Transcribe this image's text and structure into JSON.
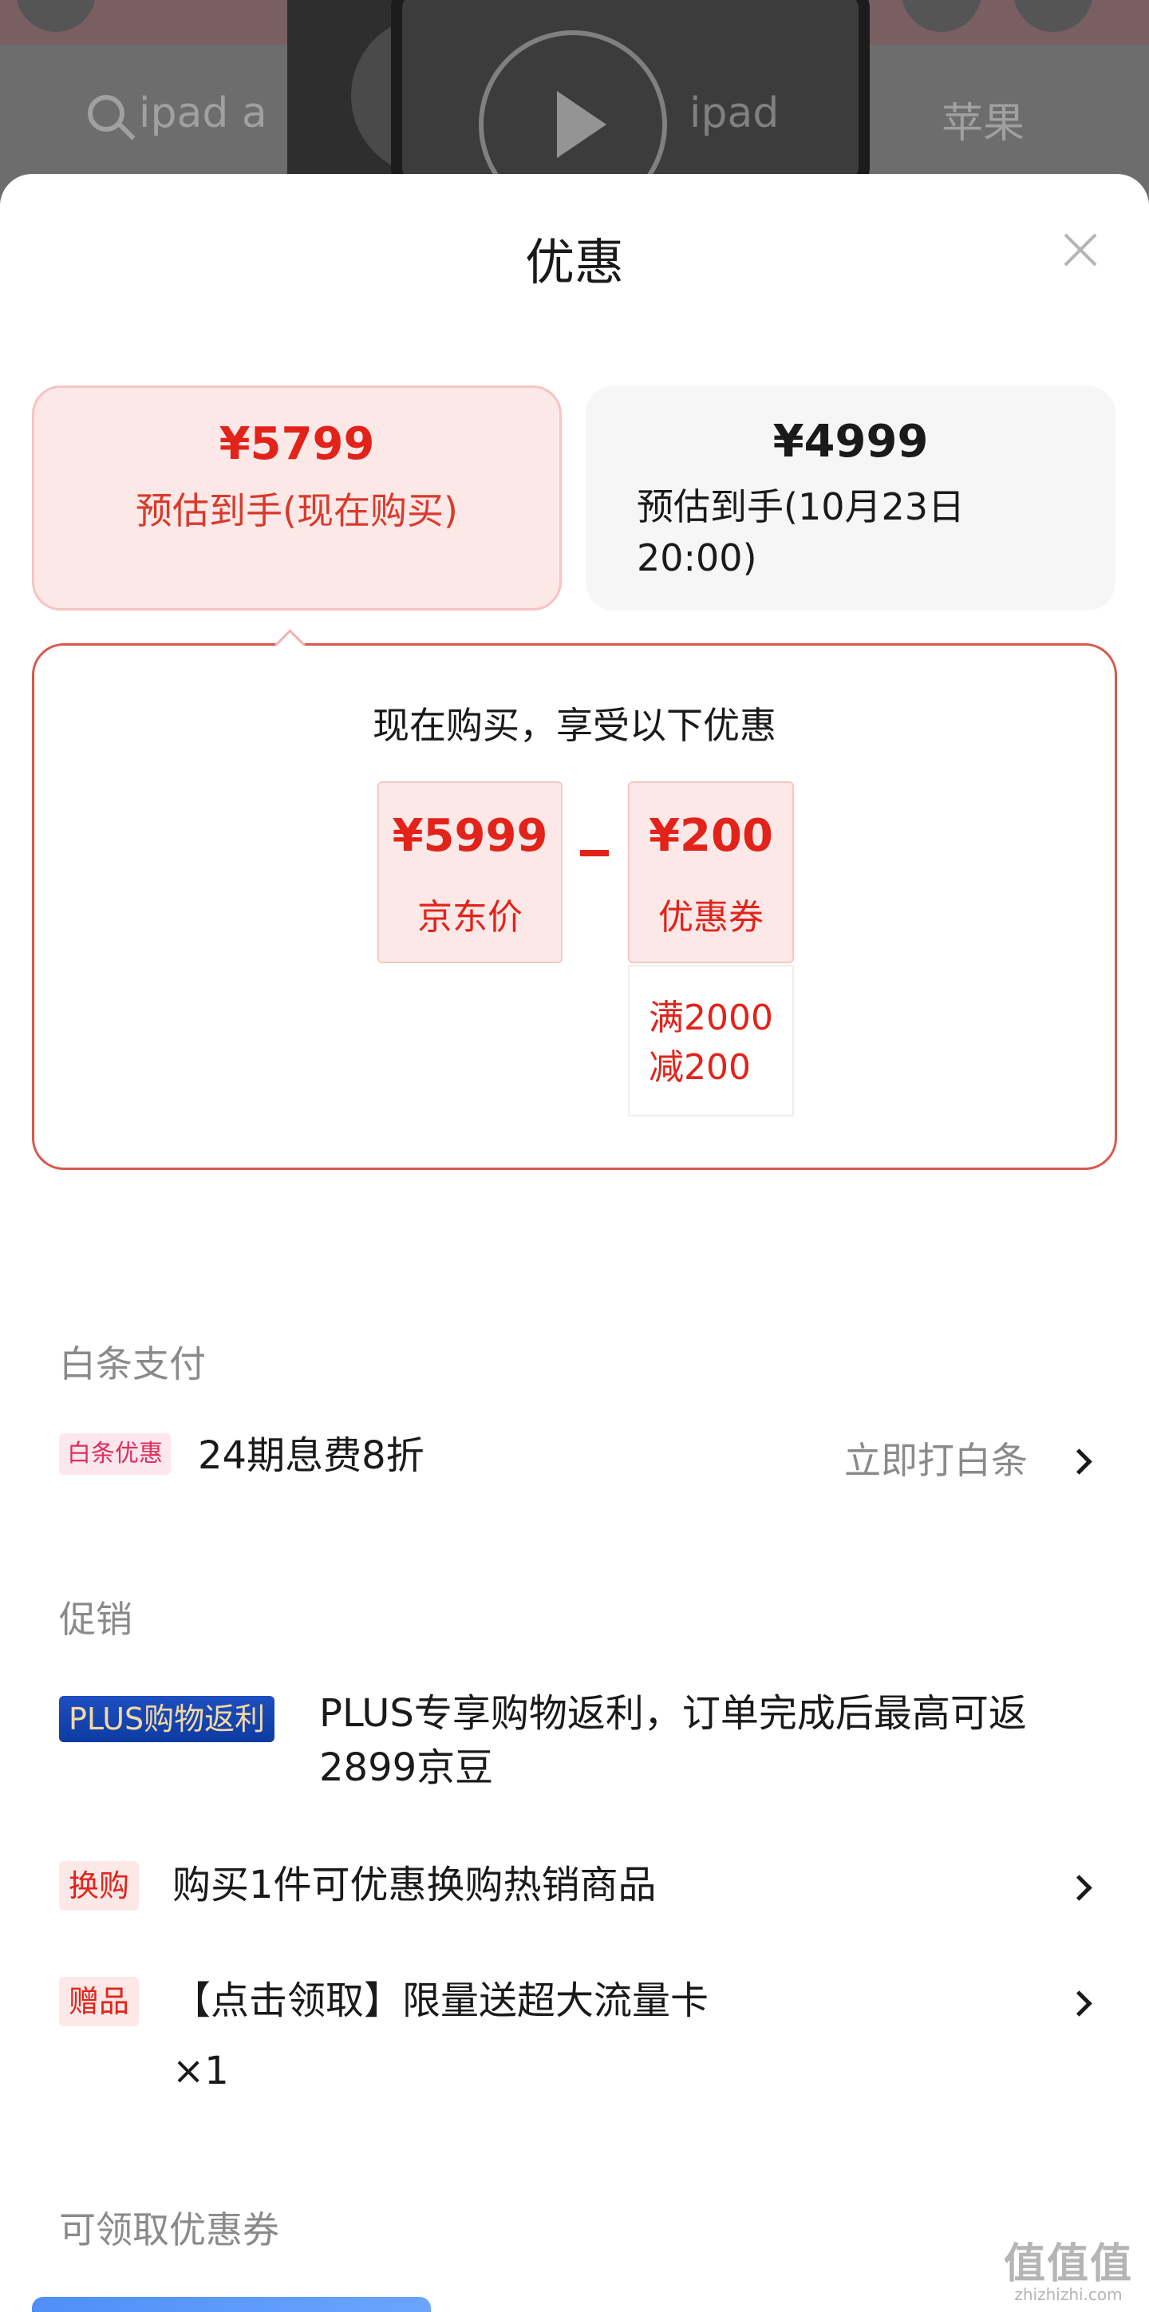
{
  "background": {
    "search_text": "ipad a",
    "tab_ipad": "ipad",
    "tab_apple": "苹果"
  },
  "sheet": {
    "title": "优惠"
  },
  "options": [
    {
      "price": "¥5799",
      "label": "预估到手(现在购买)",
      "selected": true
    },
    {
      "price": "¥4999",
      "label": "预估到手(10月23日20:00)",
      "selected": false
    }
  ],
  "detail": {
    "title": "现在购买，享受以下优惠",
    "jd_price": {
      "value": "¥5999",
      "label": "京东价"
    },
    "coupon": {
      "value": "¥200",
      "label": "优惠券",
      "rule_line1": "满2000",
      "rule_line2": "减200"
    }
  },
  "baitiao": {
    "header": "白条支付",
    "tag": "白条优惠",
    "text": "24期息费8折",
    "action": "立即打白条"
  },
  "promo": {
    "header": "促销",
    "items": [
      {
        "tag": "PLUS购物返利",
        "text_line1": "PLUS专享购物返利，订单完成后最高可返",
        "text_line2": "2899京豆"
      },
      {
        "tag": "换购",
        "text_line1": "购买1件可优惠换购热销商品"
      },
      {
        "tag": "赠品",
        "text_line1": "【点击领取】限量送超大流量卡",
        "text_line2": "×1"
      }
    ]
  },
  "coupons": {
    "header": "可领取优惠券"
  },
  "watermark": {
    "logo": "值值值",
    "url": "zhizhizhi.com"
  },
  "colors": {
    "accent": "#e2231a",
    "selected_bg": "#fde8e8",
    "plus_tag": "#1e4fbf"
  }
}
